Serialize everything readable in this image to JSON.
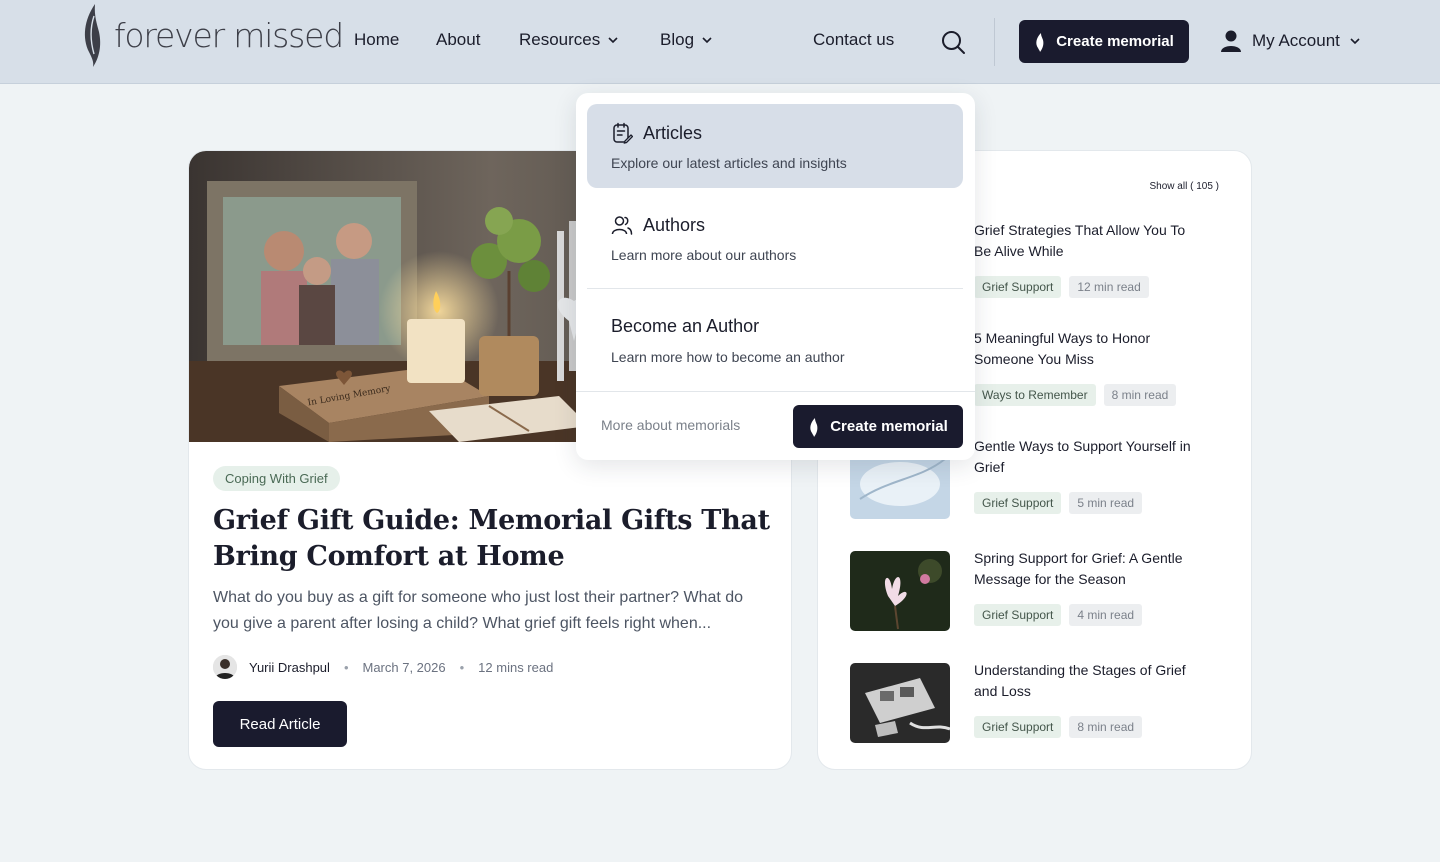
{
  "header": {
    "logo_text": "forever missed",
    "nav": {
      "home": "Home",
      "about": "About",
      "resources": "Resources",
      "blog": "Blog",
      "contact": "Contact us"
    },
    "create_memorial": "Create memorial",
    "account": "My Account"
  },
  "dropdown": {
    "articles_title": "Articles",
    "articles_desc": "Explore our latest articles and insights",
    "authors_title": "Authors",
    "authors_desc": "Learn more about our authors",
    "become_title": "Become an Author",
    "become_desc": "Learn more how to become an author",
    "more": "More about memorials",
    "create": "Create memorial"
  },
  "featured": {
    "image_caption": "In Loving Memory",
    "tag": "Coping With Grief",
    "title": "Grief Gift Guide: Memorial Gifts That Bring Comfort at Home",
    "excerpt": "What do you buy as a gift for someone who just lost their partner? What do you give a parent after losing a child? What grief gift feels right when...",
    "author": "Yurii Drashpul",
    "date": "March 7, 2026",
    "read_time": "12 mins read",
    "button": "Read Article"
  },
  "sidebar": {
    "show_all": "Show all ( 105 )",
    "items": [
      {
        "title": "Grief Strategies That Allow You To Be Alive While",
        "tag": "Grief Support",
        "read": "12 min read"
      },
      {
        "title": "5 Meaningful Ways to Honor Someone You Miss",
        "tag": "Ways to Remember",
        "read": "8 min read"
      },
      {
        "title": "Gentle Ways to Support Yourself in Grief",
        "tag": "Grief Support",
        "read": "5 min read"
      },
      {
        "title": "Spring Support for Grief: A Gentle Message for the Season",
        "tag": "Grief Support",
        "read": "4 min read"
      },
      {
        "title": "Understanding the Stages of Grief and Loss",
        "tag": "Grief Support",
        "read": "8 min read"
      }
    ]
  },
  "colors": {
    "header_bg": "#d7dfe8",
    "page_bg": "#eff3f5",
    "primary_dark": "#1a1b2e",
    "tag_green_bg": "#e7f0ea",
    "dropdown_active_bg": "#d7dee8"
  },
  "icons": {
    "logo": "flame-leaf-icon",
    "search": "search-icon",
    "chevron": "chevron-down-icon",
    "flame": "flame-icon",
    "user": "user-icon",
    "articles": "article-edit-icon",
    "authors": "users-icon"
  }
}
